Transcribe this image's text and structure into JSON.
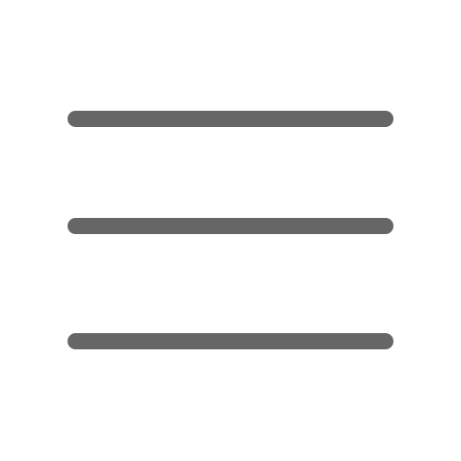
{
  "icon": {
    "name": "hamburger-menu-icon",
    "line_count": 3,
    "color": "#666666",
    "background": "#ffffff"
  }
}
